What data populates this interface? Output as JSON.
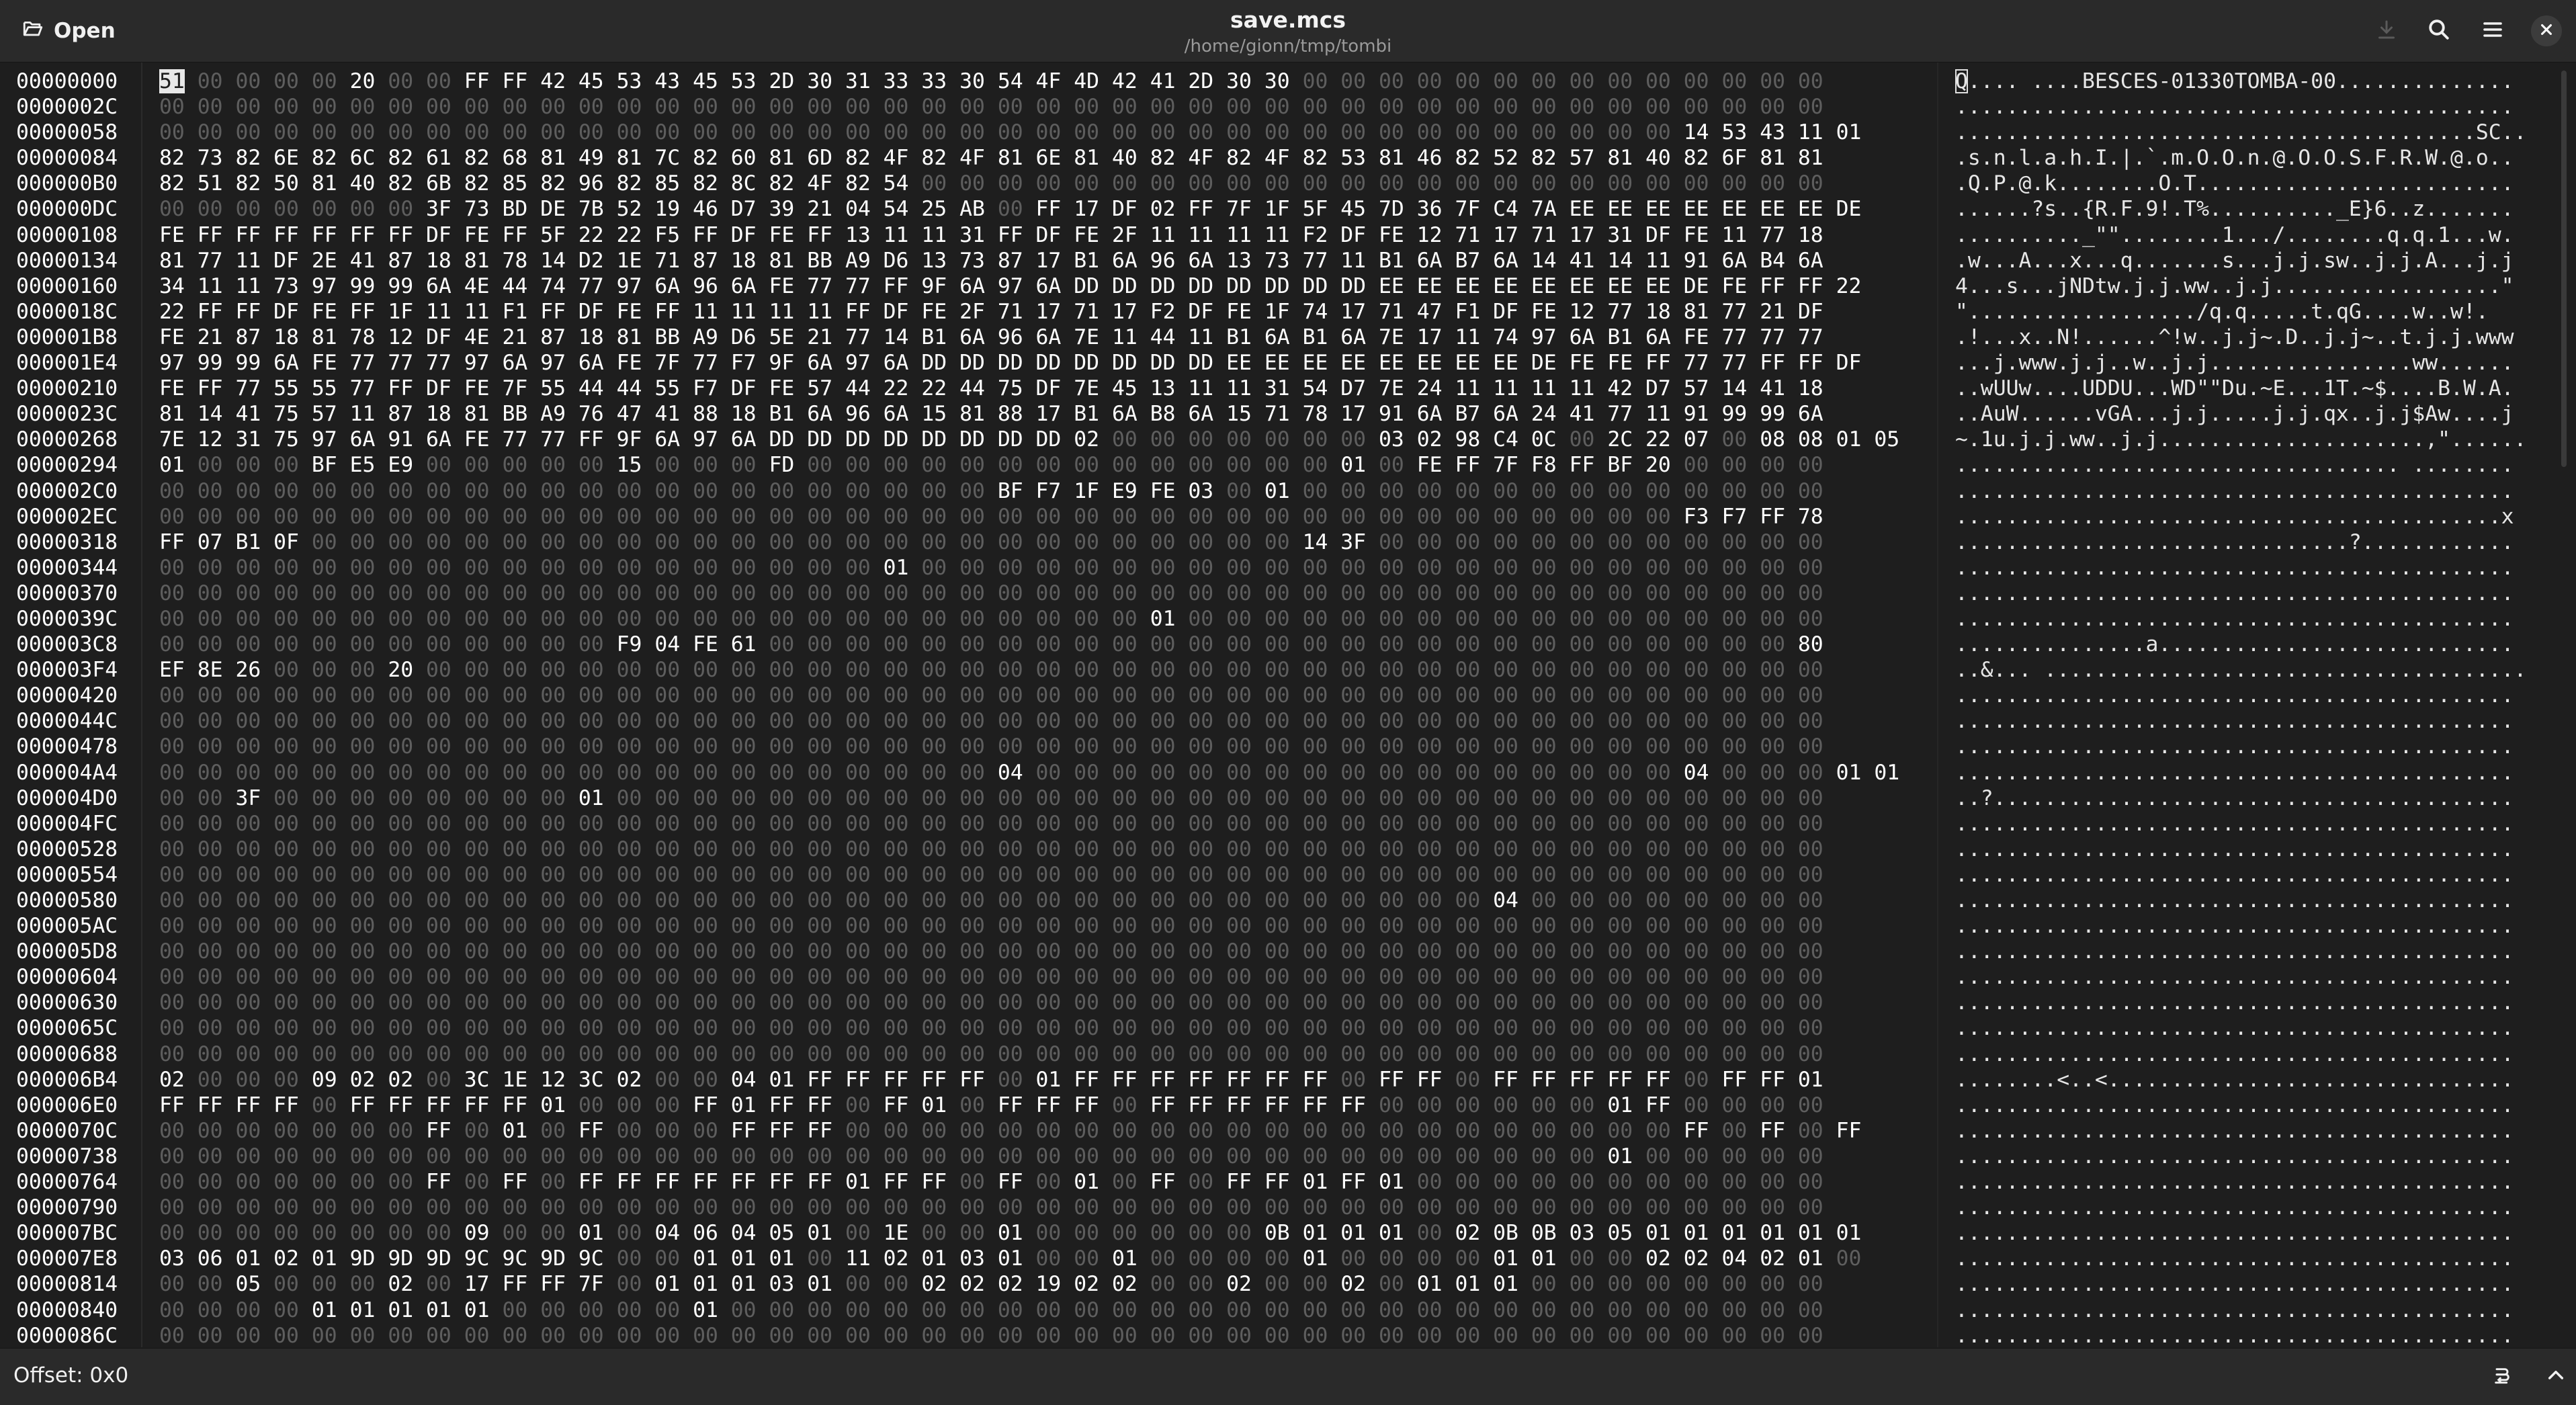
{
  "header": {
    "open_label": "Open",
    "title": "save.mcs",
    "subtitle": "/home/gionn/tmp/tombi",
    "icons": {
      "open": "folder-open-icon",
      "download": "download-icon",
      "search": "search-icon",
      "menu": "hamburger-menu-icon",
      "close": "close-icon"
    }
  },
  "footer": {
    "offset_text": "Offset: 0x0",
    "icons": {
      "encoding": "text-encoding-icon",
      "expand": "chevron-up-icon"
    }
  },
  "colors": {
    "background": "#1e1e1e",
    "header": "#2a2a2a",
    "zero_byte": "#5e5e5e",
    "text": "#ffffff"
  },
  "hex_view": {
    "bytes_per_row": 44,
    "rows": [
      {
        "offset": "00000000",
        "hex": "51 00 00 00 00 20 00 00 FF FF 42 45 53 43 45 53 2D 30 31 33 33 30 54 4F 4D 42 41 2D 30 30 00 00 00 00 00 00 00 00 00 00 00 00 00 00",
        "ascii": "Q.... ....BESCES-01330TOMBA-00.............."
      },
      {
        "offset": "0000002C",
        "hex": "00 00 00 00 00 00 00 00 00 00 00 00 00 00 00 00 00 00 00 00 00 00 00 00 00 00 00 00 00 00 00 00 00 00 00 00 00 00 00 00 00 00 00 00",
        "ascii": "............................................"
      },
      {
        "offset": "00000058",
        "hex": "00 00 00 00 00 00 00 00 00 00 00 00 00 00 00 00 00 00 00 00 00 00 00 00 00 00 00 00 00 00 00 00 00 00 00 00 00 00 00 00 14 53 43 11 01",
        "ascii": ".........................................SC.."
      },
      {
        "offset": "00000084",
        "hex": "82 73 82 6E 82 6C 82 61 82 68 81 49 81 7C 82 60 81 6D 82 4F 82 4F 81 6E 81 40 82 4F 82 4F 82 53 81 46 82 52 82 57 81 40 82 6F 81 81",
        "ascii": ".s.n.l.a.h.I.|.`.m.O.O.n.@.O.O.S.F.R.W.@.o.."
      },
      {
        "offset": "000000B0",
        "hex": "82 51 82 50 81 40 82 6B 82 85 82 96 82 85 82 8C 82 4F 82 54 00 00 00 00 00 00 00 00 00 00 00 00 00 00 00 00 00 00 00 00 00 00 00 00",
        "ascii": ".Q.P.@.k........O.T........................."
      },
      {
        "offset": "000000DC",
        "hex": "00 00 00 00 00 00 00 3F 73 BD DE 7B 52 19 46 D7 39 21 04 54 25 AB 00 FF 17 DF 02 FF 7F 1F 5F 45 7D 36 7F C4 7A EE EE EE EE EE EE EE DE",
        "ascii": "......?s..{R.F.9!.T%.........._E}6..z......."
      },
      {
        "offset": "00000108",
        "hex": "FE FF FF FF FF FF FF DF FE FF 5F 22 22 F5 FF DF FE FF 13 11 11 31 FF DF FE 2F 11 11 11 11 F2 DF FE 12 71 17 71 17 31 DF FE 11 77 18",
        "ascii": ".........._\"\"........1.../........q.q.1...w."
      },
      {
        "offset": "00000134",
        "hex": "81 77 11 DF 2E 41 87 18 81 78 14 D2 1E 71 87 18 81 BB A9 D6 13 73 87 17 B1 6A 96 6A 13 73 77 11 B1 6A B7 6A 14 41 14 11 91 6A B4 6A",
        "ascii": ".w...A...x...q.......s...j.j.sw..j.j.A...j.j"
      },
      {
        "offset": "00000160",
        "hex": "34 11 11 73 97 99 99 6A 4E 44 74 77 97 6A 96 6A FE 77 77 FF 9F 6A 97 6A DD DD DD DD DD DD DD DD EE EE EE EE EE EE EE EE DE FE FF FF 22",
        "ascii": "4...s...jNDtw.j.j.ww..j.j..................\""
      },
      {
        "offset": "0000018C",
        "hex": "22 FF FF DF FE FF 1F 11 11 F1 FF DF FE FF 11 11 11 11 FF DF FE 2F 71 17 71 17 F2 DF FE 1F 74 17 71 47 F1 DF FE 12 77 18 81 77 21 DF",
        "ascii": "\"................../q.q.....t.qG....w..w!."
      },
      {
        "offset": "000001B8",
        "hex": "FE 21 87 18 81 78 12 DF 4E 21 87 18 81 BB A9 D6 5E 21 77 14 B1 6A 96 6A 7E 11 44 11 B1 6A B1 6A 7E 17 11 74 97 6A B1 6A FE 77 77 77",
        "ascii": ".!...x..N!......^!w..j.j~.D..j.j~..t.j.j.www"
      },
      {
        "offset": "000001E4",
        "hex": "97 99 99 6A FE 77 77 77 97 6A 97 6A FE 7F 77 F7 9F 6A 97 6A DD DD DD DD DD DD DD DD EE EE EE EE EE EE EE EE DE FE FE FF 77 77 FF FF DF",
        "ascii": "...j.www.j.j..w..j.j................ww......"
      },
      {
        "offset": "00000210",
        "hex": "FE FF 77 55 55 77 FF DF FE 7F 55 44 44 55 F7 DF FE 57 44 22 22 44 75 DF 7E 45 13 11 11 31 54 D7 7E 24 11 11 11 11 42 D7 57 14 41 18",
        "ascii": "..wUUw....UDDU...WD\"\"Du.~E...1T.~$....B.W.A."
      },
      {
        "offset": "0000023C",
        "hex": "81 14 41 75 57 11 87 18 81 BB A9 76 47 41 88 18 B1 6A 96 6A 15 81 88 17 B1 6A B8 6A 15 71 78 17 91 6A B7 6A 24 41 77 11 91 99 99 6A",
        "ascii": "..AuW......vGA...j.j.....j.j.qx..j.j$Aw....j"
      },
      {
        "offset": "00000268",
        "hex": "7E 12 31 75 97 6A 91 6A FE 77 77 FF 9F 6A 97 6A DD DD DD DD DD DD DD DD 02 00 00 00 00 00 00 00 03 02 98 C4 0C 00 2C 22 07 00 08 08 01 05",
        "ascii": "~.1u.j.j.ww..j.j.....................,\"......"
      },
      {
        "offset": "00000294",
        "hex": "01 00 00 00 BF E5 E9 00 00 00 00 00 15 00 00 00 FD 00 00 00 00 00 00 00 00 00 00 00 00 00 00 01 00 FE FF 7F F8 FF BF 20 00 00 00 00",
        "ascii": "................................... ........"
      },
      {
        "offset": "000002C0",
        "hex": "00 00 00 00 00 00 00 00 00 00 00 00 00 00 00 00 00 00 00 00 00 00 BF F7 1F E9 FE 03 00 01 00 00 00 00 00 00 00 00 00 00 00 00 00 00",
        "ascii": "............................................"
      },
      {
        "offset": "000002EC",
        "hex": "00 00 00 00 00 00 00 00 00 00 00 00 00 00 00 00 00 00 00 00 00 00 00 00 00 00 00 00 00 00 00 00 00 00 00 00 00 00 00 00 F3 F7 FF 78",
        "ascii": "...........................................x"
      },
      {
        "offset": "00000318",
        "hex": "FF 07 B1 0F 00 00 00 00 00 00 00 00 00 00 00 00 00 00 00 00 00 00 00 00 00 00 00 00 00 00 14 3F 00 00 00 00 00 00 00 00 00 00 00 00",
        "ascii": "...............................?............"
      },
      {
        "offset": "00000344",
        "hex": "00 00 00 00 00 00 00 00 00 00 00 00 00 00 00 00 00 00 00 01 00 00 00 00 00 00 00 00 00 00 00 00 00 00 00 00 00 00 00 00 00 00 00 00",
        "ascii": "............................................"
      },
      {
        "offset": "00000370",
        "hex": "00 00 00 00 00 00 00 00 00 00 00 00 00 00 00 00 00 00 00 00 00 00 00 00 00 00 00 00 00 00 00 00 00 00 00 00 00 00 00 00 00 00 00 00",
        "ascii": "............................................"
      },
      {
        "offset": "0000039C",
        "hex": "00 00 00 00 00 00 00 00 00 00 00 00 00 00 00 00 00 00 00 00 00 00 00 00 00 00 01 00 00 00 00 00 00 00 00 00 00 00 00 00 00 00 00 00",
        "ascii": "............................................"
      },
      {
        "offset": "000003C8",
        "hex": "00 00 00 00 00 00 00 00 00 00 00 00 F9 04 FE 61 00 00 00 00 00 00 00 00 00 00 00 00 00 00 00 00 00 00 00 00 00 00 00 00 00 00 00 80",
        "ascii": "...............a............................"
      },
      {
        "offset": "000003F4",
        "hex": "EF 8E 26 00 00 00 20 00 00 00 00 00 00 00 00 00 00 00 00 00 00 00 00 00 00 00 00 00 00 00 00 00 00 00 00 00 00 00 00 00 00 00 00 00",
        "ascii": "..&... ......................................"
      },
      {
        "offset": "00000420",
        "hex": "00 00 00 00 00 00 00 00 00 00 00 00 00 00 00 00 00 00 00 00 00 00 00 00 00 00 00 00 00 00 00 00 00 00 00 00 00 00 00 00 00 00 00 00",
        "ascii": "............................................"
      },
      {
        "offset": "0000044C",
        "hex": "00 00 00 00 00 00 00 00 00 00 00 00 00 00 00 00 00 00 00 00 00 00 00 00 00 00 00 00 00 00 00 00 00 00 00 00 00 00 00 00 00 00 00 00",
        "ascii": "............................................"
      },
      {
        "offset": "00000478",
        "hex": "00 00 00 00 00 00 00 00 00 00 00 00 00 00 00 00 00 00 00 00 00 00 00 00 00 00 00 00 00 00 00 00 00 00 00 00 00 00 00 00 00 00 00 00",
        "ascii": "............................................"
      },
      {
        "offset": "000004A4",
        "hex": "00 00 00 00 00 00 00 00 00 00 00 00 00 00 00 00 00 00 00 00 00 00 04 00 00 00 00 00 00 00 00 00 00 00 00 00 00 00 00 00 04 00 00 00 01 01",
        "ascii": "............................................"
      },
      {
        "offset": "000004D0",
        "hex": "00 00 3F 00 00 00 00 00 00 00 00 01 00 00 00 00 00 00 00 00 00 00 00 00 00 00 00 00 00 00 00 00 00 00 00 00 00 00 00 00 00 00 00 00",
        "ascii": "..?........................................."
      },
      {
        "offset": "000004FC",
        "hex": "00 00 00 00 00 00 00 00 00 00 00 00 00 00 00 00 00 00 00 00 00 00 00 00 00 00 00 00 00 00 00 00 00 00 00 00 00 00 00 00 00 00 00 00",
        "ascii": "............................................"
      },
      {
        "offset": "00000528",
        "hex": "00 00 00 00 00 00 00 00 00 00 00 00 00 00 00 00 00 00 00 00 00 00 00 00 00 00 00 00 00 00 00 00 00 00 00 00 00 00 00 00 00 00 00 00",
        "ascii": "............................................"
      },
      {
        "offset": "00000554",
        "hex": "00 00 00 00 00 00 00 00 00 00 00 00 00 00 00 00 00 00 00 00 00 00 00 00 00 00 00 00 00 00 00 00 00 00 00 00 00 00 00 00 00 00 00 00",
        "ascii": "............................................"
      },
      {
        "offset": "00000580",
        "hex": "00 00 00 00 00 00 00 00 00 00 00 00 00 00 00 00 00 00 00 00 00 00 00 00 00 00 00 00 00 00 00 00 00 00 00 04 00 00 00 00 00 00 00 00",
        "ascii": "............................................"
      },
      {
        "offset": "000005AC",
        "hex": "00 00 00 00 00 00 00 00 00 00 00 00 00 00 00 00 00 00 00 00 00 00 00 00 00 00 00 00 00 00 00 00 00 00 00 00 00 00 00 00 00 00 00 00",
        "ascii": "............................................"
      },
      {
        "offset": "000005D8",
        "hex": "00 00 00 00 00 00 00 00 00 00 00 00 00 00 00 00 00 00 00 00 00 00 00 00 00 00 00 00 00 00 00 00 00 00 00 00 00 00 00 00 00 00 00 00",
        "ascii": "............................................"
      },
      {
        "offset": "00000604",
        "hex": "00 00 00 00 00 00 00 00 00 00 00 00 00 00 00 00 00 00 00 00 00 00 00 00 00 00 00 00 00 00 00 00 00 00 00 00 00 00 00 00 00 00 00 00",
        "ascii": "............................................"
      },
      {
        "offset": "00000630",
        "hex": "00 00 00 00 00 00 00 00 00 00 00 00 00 00 00 00 00 00 00 00 00 00 00 00 00 00 00 00 00 00 00 00 00 00 00 00 00 00 00 00 00 00 00 00",
        "ascii": "............................................"
      },
      {
        "offset": "0000065C",
        "hex": "00 00 00 00 00 00 00 00 00 00 00 00 00 00 00 00 00 00 00 00 00 00 00 00 00 00 00 00 00 00 00 00 00 00 00 00 00 00 00 00 00 00 00 00",
        "ascii": "............................................"
      },
      {
        "offset": "00000688",
        "hex": "00 00 00 00 00 00 00 00 00 00 00 00 00 00 00 00 00 00 00 00 00 00 00 00 00 00 00 00 00 00 00 00 00 00 00 00 00 00 00 00 00 00 00 00",
        "ascii": "............................................"
      },
      {
        "offset": "000006B4",
        "hex": "02 00 00 00 09 02 02 00 3C 1E 12 3C 02 00 00 04 01 FF FF FF FF FF 00 01 FF FF FF FF FF FF FF 00 FF FF 00 FF FF FF FF FF 00 FF FF 01",
        "ascii": "........<..<................................"
      },
      {
        "offset": "000006E0",
        "hex": "FF FF FF FF 00 FF FF FF FF FF 01 00 00 00 FF 01 FF FF 00 FF 01 00 FF FF FF 00 FF FF FF FF FF FF 00 00 00 00 00 00 01 FF 00 00 00 00",
        "ascii": "............................................"
      },
      {
        "offset": "0000070C",
        "hex": "00 00 00 00 00 00 00 FF 00 01 00 FF 00 00 00 FF FF FF 00 00 00 00 00 00 00 00 00 00 00 00 00 00 00 00 00 00 00 00 00 00 FF 00 FF 00 FF",
        "ascii": "............................................"
      },
      {
        "offset": "00000738",
        "hex": "00 00 00 00 00 00 00 00 00 00 00 00 00 00 00 00 00 00 00 00 00 00 00 00 00 00 00 00 00 00 00 00 00 00 00 00 00 00 01 00 00 00 00 00",
        "ascii": "............................................"
      },
      {
        "offset": "00000764",
        "hex": "00 00 00 00 00 00 00 FF 00 FF 00 FF FF FF FF FF FF FF 01 FF FF 00 FF 00 01 00 FF 00 FF FF 01 FF 01 00 00 00 00 00 00 00 00 00 00 00",
        "ascii": "............................................"
      },
      {
        "offset": "00000790",
        "hex": "00 00 00 00 00 00 00 00 00 00 00 00 00 00 00 00 00 00 00 00 00 00 00 00 00 00 00 00 00 00 00 00 00 00 00 00 00 00 00 00 00 00 00 00",
        "ascii": "............................................"
      },
      {
        "offset": "000007BC",
        "hex": "00 00 00 00 00 00 00 00 09 00 00 01 00 04 06 04 05 01 00 1E 00 00 01 00 00 00 00 00 00 0B 01 01 01 00 02 0B 0B 03 05 01 01 01 01 01 01",
        "ascii": "............................................"
      },
      {
        "offset": "000007E8",
        "hex": "03 06 01 02 01 9D 9D 9D 9C 9C 9D 9C 00 00 01 01 01 00 11 02 01 03 01 00 00 01 00 00 00 00 01 00 00 00 00 01 01 00 00 02 02 04 02 01 00",
        "ascii": "............................................"
      },
      {
        "offset": "00000814",
        "hex": "00 00 05 00 00 00 02 00 17 FF FF 7F 00 01 01 01 03 01 00 00 02 02 02 19 02 02 00 00 02 00 00 02 00 01 01 01 00 00 00 00 00 00 00 00",
        "ascii": "............................................"
      },
      {
        "offset": "00000840",
        "hex": "00 00 00 00 01 01 01 01 01 00 00 00 00 00 01 00 00 00 00 00 00 00 00 00 00 00 00 00 00 00 00 00 00 00 00 00 00 00 00 00 00 00 00 00",
        "ascii": "............................................"
      },
      {
        "offset": "0000086C",
        "hex": "00 00 00 00 00 00 00 00 00 00 00 00 00 00 00 00 00 00 00 00 00 00 00 00 00 00 00 00 00 00 00 00 00 00 00 00 00 00 00 00 00 00 00 00",
        "ascii": "............................................"
      }
    ]
  }
}
